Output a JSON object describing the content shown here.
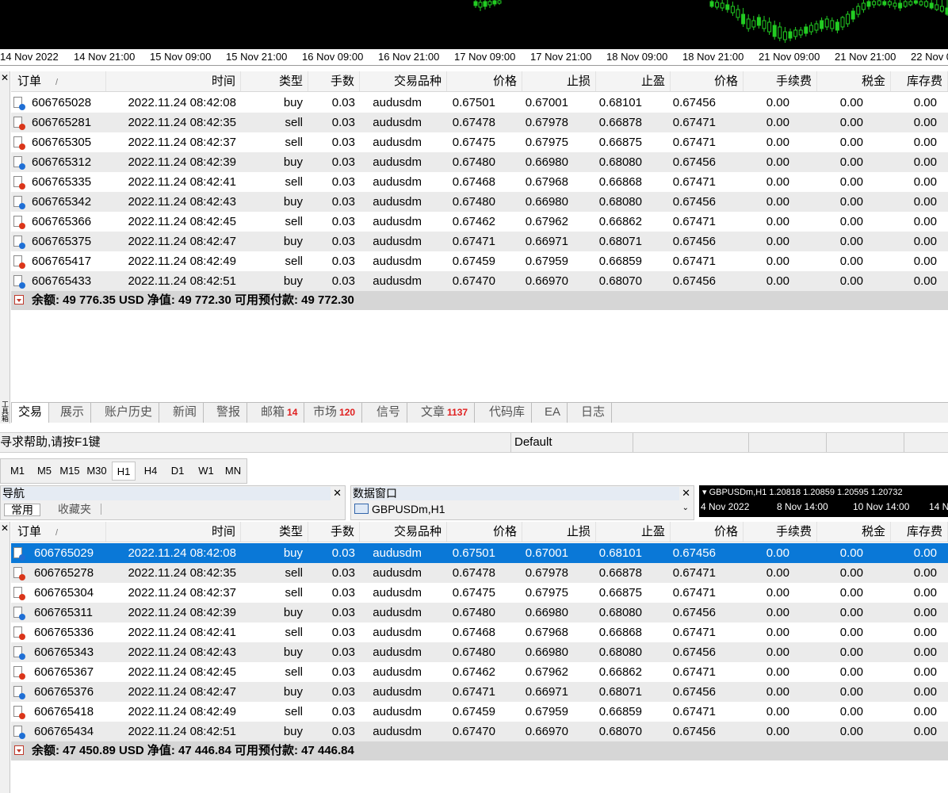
{
  "chart_top": {
    "time_labels": [
      "14 Nov 2022",
      "14 Nov 21:00",
      "15 Nov 09:00",
      "15 Nov 21:00",
      "16 Nov 09:00",
      "16 Nov 21:00",
      "17 Nov 09:00",
      "17 Nov 21:00",
      "18 Nov 09:00",
      "18 Nov 21:00",
      "21 Nov 09:00",
      "21 Nov 21:00",
      "22 Nov 0"
    ]
  },
  "columns": {
    "order": "订单",
    "sort_mark": "/",
    "time": "时间",
    "type": "类型",
    "volume": "手数",
    "symbol": "交易品种",
    "price": "价格",
    "sl": "止损",
    "tp": "止盈",
    "price2": "价格",
    "commission": "手续费",
    "tax": "税金",
    "swap": "库存费"
  },
  "terminal1": {
    "rows": [
      {
        "order": "606765028",
        "time": "2022.11.24 08:42:08",
        "type": "buy",
        "volume": "0.03",
        "symbol": "audusdm",
        "price": "0.67501",
        "sl": "0.67001",
        "tp": "0.68101",
        "price2": "0.67456",
        "commission": "0.00",
        "tax": "0.00",
        "swap": "0.00"
      },
      {
        "order": "606765281",
        "time": "2022.11.24 08:42:35",
        "type": "sell",
        "volume": "0.03",
        "symbol": "audusdm",
        "price": "0.67478",
        "sl": "0.67978",
        "tp": "0.66878",
        "price2": "0.67471",
        "commission": "0.00",
        "tax": "0.00",
        "swap": "0.00"
      },
      {
        "order": "606765305",
        "time": "2022.11.24 08:42:37",
        "type": "sell",
        "volume": "0.03",
        "symbol": "audusdm",
        "price": "0.67475",
        "sl": "0.67975",
        "tp": "0.66875",
        "price2": "0.67471",
        "commission": "0.00",
        "tax": "0.00",
        "swap": "0.00"
      },
      {
        "order": "606765312",
        "time": "2022.11.24 08:42:39",
        "type": "buy",
        "volume": "0.03",
        "symbol": "audusdm",
        "price": "0.67480",
        "sl": "0.66980",
        "tp": "0.68080",
        "price2": "0.67456",
        "commission": "0.00",
        "tax": "0.00",
        "swap": "0.00"
      },
      {
        "order": "606765335",
        "time": "2022.11.24 08:42:41",
        "type": "sell",
        "volume": "0.03",
        "symbol": "audusdm",
        "price": "0.67468",
        "sl": "0.67968",
        "tp": "0.66868",
        "price2": "0.67471",
        "commission": "0.00",
        "tax": "0.00",
        "swap": "0.00"
      },
      {
        "order": "606765342",
        "time": "2022.11.24 08:42:43",
        "type": "buy",
        "volume": "0.03",
        "symbol": "audusdm",
        "price": "0.67480",
        "sl": "0.66980",
        "tp": "0.68080",
        "price2": "0.67456",
        "commission": "0.00",
        "tax": "0.00",
        "swap": "0.00"
      },
      {
        "order": "606765366",
        "time": "2022.11.24 08:42:45",
        "type": "sell",
        "volume": "0.03",
        "symbol": "audusdm",
        "price": "0.67462",
        "sl": "0.67962",
        "tp": "0.66862",
        "price2": "0.67471",
        "commission": "0.00",
        "tax": "0.00",
        "swap": "0.00"
      },
      {
        "order": "606765375",
        "time": "2022.11.24 08:42:47",
        "type": "buy",
        "volume": "0.03",
        "symbol": "audusdm",
        "price": "0.67471",
        "sl": "0.66971",
        "tp": "0.68071",
        "price2": "0.67456",
        "commission": "0.00",
        "tax": "0.00",
        "swap": "0.00"
      },
      {
        "order": "606765417",
        "time": "2022.11.24 08:42:49",
        "type": "sell",
        "volume": "0.03",
        "symbol": "audusdm",
        "price": "0.67459",
        "sl": "0.67959",
        "tp": "0.66859",
        "price2": "0.67471",
        "commission": "0.00",
        "tax": "0.00",
        "swap": "0.00"
      },
      {
        "order": "606765433",
        "time": "2022.11.24 08:42:51",
        "type": "buy",
        "volume": "0.03",
        "symbol": "audusdm",
        "price": "0.67470",
        "sl": "0.66970",
        "tp": "0.68070",
        "price2": "0.67456",
        "commission": "0.00",
        "tax": "0.00",
        "swap": "0.00"
      }
    ],
    "summary": "余额: 49 776.35 USD  净值: 49 772.30  可用预付款: 49 772.30"
  },
  "tabs": [
    {
      "label": "交易",
      "badge": ""
    },
    {
      "label": "展示",
      "badge": ""
    },
    {
      "label": "账户历史",
      "badge": ""
    },
    {
      "label": "新闻",
      "badge": ""
    },
    {
      "label": "警报",
      "badge": ""
    },
    {
      "label": "邮箱",
      "badge": "14"
    },
    {
      "label": "市场",
      "badge": "120"
    },
    {
      "label": "信号",
      "badge": ""
    },
    {
      "label": "文章",
      "badge": "1137"
    },
    {
      "label": "代码库",
      "badge": ""
    },
    {
      "label": "EA",
      "badge": ""
    },
    {
      "label": "日志",
      "badge": ""
    }
  ],
  "side_label": "工具箱",
  "statusbar": {
    "help": "寻求帮助,请按F1键",
    "profile": "Default"
  },
  "periods": [
    "M1",
    "M5",
    "M15",
    "M30",
    "H1",
    "H4",
    "D1",
    "W1",
    "MN"
  ],
  "active_period": "H1",
  "navigator": {
    "title": "导航",
    "tab1": "常用",
    "tab2": "收藏夹"
  },
  "data_window": {
    "title": "数据窗口",
    "item": "GBPUSDm,H1"
  },
  "mini_chart": {
    "header": "GBPUSDm,H1  1.20818 1.20859 1.20595 1.20732",
    "labels": [
      "4 Nov 2022",
      "8 Nov 14:00",
      "10 Nov 14:00",
      "14 N"
    ]
  },
  "terminal2": {
    "rows": [
      {
        "order": "606765029",
        "time": "2022.11.24 08:42:08",
        "type": "buy",
        "volume": "0.03",
        "symbol": "audusdm",
        "price": "0.67501",
        "sl": "0.67001",
        "tp": "0.68101",
        "price2": "0.67456",
        "commission": "0.00",
        "tax": "0.00",
        "swap": "0.00"
      },
      {
        "order": "606765278",
        "time": "2022.11.24 08:42:35",
        "type": "sell",
        "volume": "0.03",
        "symbol": "audusdm",
        "price": "0.67478",
        "sl": "0.67978",
        "tp": "0.66878",
        "price2": "0.67471",
        "commission": "0.00",
        "tax": "0.00",
        "swap": "0.00"
      },
      {
        "order": "606765304",
        "time": "2022.11.24 08:42:37",
        "type": "sell",
        "volume": "0.03",
        "symbol": "audusdm",
        "price": "0.67475",
        "sl": "0.67975",
        "tp": "0.66875",
        "price2": "0.67471",
        "commission": "0.00",
        "tax": "0.00",
        "swap": "0.00"
      },
      {
        "order": "606765311",
        "time": "2022.11.24 08:42:39",
        "type": "buy",
        "volume": "0.03",
        "symbol": "audusdm",
        "price": "0.67480",
        "sl": "0.66980",
        "tp": "0.68080",
        "price2": "0.67456",
        "commission": "0.00",
        "tax": "0.00",
        "swap": "0.00"
      },
      {
        "order": "606765336",
        "time": "2022.11.24 08:42:41",
        "type": "sell",
        "volume": "0.03",
        "symbol": "audusdm",
        "price": "0.67468",
        "sl": "0.67968",
        "tp": "0.66868",
        "price2": "0.67471",
        "commission": "0.00",
        "tax": "0.00",
        "swap": "0.00"
      },
      {
        "order": "606765343",
        "time": "2022.11.24 08:42:43",
        "type": "buy",
        "volume": "0.03",
        "symbol": "audusdm",
        "price": "0.67480",
        "sl": "0.66980",
        "tp": "0.68080",
        "price2": "0.67456",
        "commission": "0.00",
        "tax": "0.00",
        "swap": "0.00"
      },
      {
        "order": "606765367",
        "time": "2022.11.24 08:42:45",
        "type": "sell",
        "volume": "0.03",
        "symbol": "audusdm",
        "price": "0.67462",
        "sl": "0.67962",
        "tp": "0.66862",
        "price2": "0.67471",
        "commission": "0.00",
        "tax": "0.00",
        "swap": "0.00"
      },
      {
        "order": "606765376",
        "time": "2022.11.24 08:42:47",
        "type": "buy",
        "volume": "0.03",
        "symbol": "audusdm",
        "price": "0.67471",
        "sl": "0.66971",
        "tp": "0.68071",
        "price2": "0.67456",
        "commission": "0.00",
        "tax": "0.00",
        "swap": "0.00"
      },
      {
        "order": "606765418",
        "time": "2022.11.24 08:42:49",
        "type": "sell",
        "volume": "0.03",
        "symbol": "audusdm",
        "price": "0.67459",
        "sl": "0.67959",
        "tp": "0.66859",
        "price2": "0.67471",
        "commission": "0.00",
        "tax": "0.00",
        "swap": "0.00"
      },
      {
        "order": "606765434",
        "time": "2022.11.24 08:42:51",
        "type": "buy",
        "volume": "0.03",
        "symbol": "audusdm",
        "price": "0.67470",
        "sl": "0.66970",
        "tp": "0.68070",
        "price2": "0.67456",
        "commission": "0.00",
        "tax": "0.00",
        "swap": "0.00"
      }
    ],
    "selected_row": 0,
    "summary": "余额: 47 450.89 USD  净值: 47 446.84  可用预付款: 47 446.84"
  },
  "colors": {
    "selected_row": "#0a78d7",
    "buy_icon": "#1f6fd4",
    "sell_icon": "#d9361a",
    "badge": "#e02020",
    "candle_up": "#22cc22"
  }
}
